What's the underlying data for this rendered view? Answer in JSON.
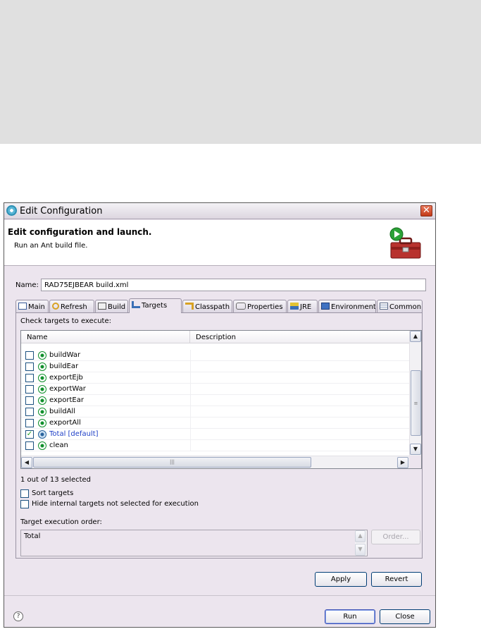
{
  "window": {
    "title": "Edit Configuration",
    "close_glyph": "✕",
    "header_title": "Edit configuration and launch.",
    "header_subtitle": "Run an Ant build file."
  },
  "name_field": {
    "label": "Name:",
    "value": "RAD75EJBEAR build.xml"
  },
  "tabs": [
    {
      "label": "Main",
      "icon": "main-tab-icon"
    },
    {
      "label": "Refresh",
      "icon": "refresh-icon"
    },
    {
      "label": "Build",
      "icon": "build-icon"
    },
    {
      "label": "Targets",
      "icon": "targets-icon"
    },
    {
      "label": "Classpath",
      "icon": "classpath-icon"
    },
    {
      "label": "Properties",
      "icon": "properties-icon"
    },
    {
      "label": "JRE",
      "icon": "jre-icon"
    },
    {
      "label": "Environment",
      "icon": "environment-icon"
    },
    {
      "label": "Common",
      "icon": "common-icon"
    }
  ],
  "active_tab": "Targets",
  "targets": {
    "check_label": "Check targets to execute:",
    "columns": [
      "Name",
      "Description"
    ],
    "rows": [
      {
        "name": "buildWar",
        "checked": false,
        "default": false
      },
      {
        "name": "buildEar",
        "checked": false,
        "default": false
      },
      {
        "name": "exportEjb",
        "checked": false,
        "default": false
      },
      {
        "name": "exportWar",
        "checked": false,
        "default": false
      },
      {
        "name": "exportEar",
        "checked": false,
        "default": false
      },
      {
        "name": "buildAll",
        "checked": false,
        "default": false
      },
      {
        "name": "exportAll",
        "checked": false,
        "default": false
      },
      {
        "name": "Total [default]",
        "checked": true,
        "default": true
      },
      {
        "name": "clean",
        "checked": false,
        "default": false
      }
    ],
    "selected_count": "1 out of 13 selected",
    "sort_targets": "Sort targets",
    "hide_internal": "Hide internal targets not selected for execution",
    "order_label": "Target execution order:",
    "order_value": "Total",
    "order_button": "Order..."
  },
  "buttons": {
    "apply": "Apply",
    "revert": "Revert",
    "run": "Run",
    "close": "Close"
  },
  "glyphs": {
    "up": "▲",
    "down": "▼",
    "left": "◀",
    "right": "▶",
    "grip_v": "≡",
    "grip_h": "|||",
    "check": "✓",
    "help": "?"
  },
  "colors": {
    "accent": "#1f40c7",
    "check": "#21a121",
    "close": "#c33a18"
  }
}
